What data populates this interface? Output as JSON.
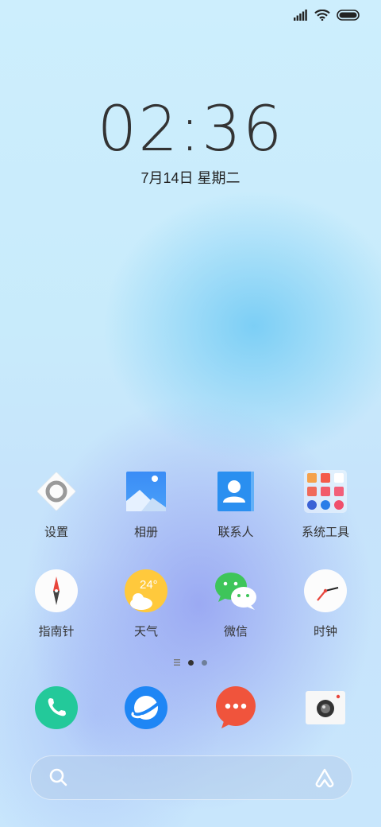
{
  "lockscreen": {
    "time": "02:36",
    "date": "7月14日 星期二"
  },
  "status_bar": {
    "icons": [
      "signal-icon",
      "wifi-icon",
      "battery-icon"
    ]
  },
  "home": {
    "row1": [
      {
        "label": "设置",
        "icon": "settings-icon"
      },
      {
        "label": "相册",
        "icon": "gallery-icon"
      },
      {
        "label": "联系人",
        "icon": "contacts-icon"
      },
      {
        "label": "系统工具",
        "icon": "system-tools-folder-icon"
      }
    ],
    "row2": [
      {
        "label": "指南针",
        "icon": "compass-icon"
      },
      {
        "label": "天气",
        "icon": "weather-icon",
        "temp": "24°"
      },
      {
        "label": "微信",
        "icon": "wechat-icon"
      },
      {
        "label": "时钟",
        "icon": "clock-icon"
      }
    ],
    "page_indicator": {
      "pages": 2,
      "current": 1
    }
  },
  "dock": [
    "phone-icon",
    "browser-icon",
    "messages-icon",
    "camera-icon"
  ],
  "search": {
    "icons": [
      "search-icon",
      "assistant-icon"
    ]
  },
  "colors": {
    "phone": "#23c99a",
    "browser": "#1e86f5",
    "messages": "#f0543c",
    "contacts": "#2a8ff0",
    "gallery": "#3d8ef5",
    "weather": "#ffc93c",
    "wechat": "#3ec55a"
  }
}
